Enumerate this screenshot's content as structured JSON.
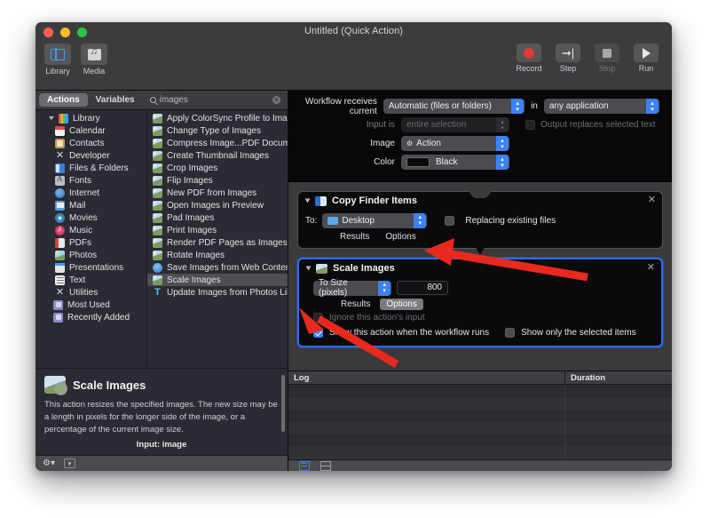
{
  "window": {
    "title": "Untitled (Quick Action)",
    "traffic_lights": [
      "close",
      "minimize",
      "zoom"
    ]
  },
  "toolbar": {
    "left": [
      {
        "icon": "library-icon",
        "label": "Library",
        "active": true
      },
      {
        "icon": "media-icon",
        "label": "Media",
        "active": false
      }
    ],
    "right": [
      {
        "icon": "record-icon",
        "label": "Record",
        "enabled": true
      },
      {
        "icon": "step-icon",
        "label": "Step",
        "enabled": true
      },
      {
        "icon": "stop-icon",
        "label": "Stop",
        "enabled": false
      },
      {
        "icon": "run-icon",
        "label": "Run",
        "enabled": true
      }
    ]
  },
  "library": {
    "segments": [
      {
        "label": "Actions",
        "active": true
      },
      {
        "label": "Variables",
        "active": false
      }
    ],
    "search": {
      "value": "images",
      "placeholder": "Search",
      "icon": "search-icon",
      "clear_icon": "clear-icon"
    },
    "categories": [
      {
        "label": "Library",
        "icon": "library-color-icon",
        "level": 0,
        "disclosure": true
      },
      {
        "label": "Calendar",
        "icon": "calendar-icon",
        "level": 1
      },
      {
        "label": "Contacts",
        "icon": "contacts-icon",
        "level": 1
      },
      {
        "label": "Developer",
        "icon": "developer-icon",
        "level": 1
      },
      {
        "label": "Files & Folders",
        "icon": "files-folders-icon",
        "level": 1
      },
      {
        "label": "Fonts",
        "icon": "fonts-icon",
        "level": 1
      },
      {
        "label": "Internet",
        "icon": "internet-icon",
        "level": 1
      },
      {
        "label": "Mail",
        "icon": "mail-icon",
        "level": 1
      },
      {
        "label": "Movies",
        "icon": "movies-icon",
        "level": 1
      },
      {
        "label": "Music",
        "icon": "music-icon",
        "level": 1
      },
      {
        "label": "PDFs",
        "icon": "pdfs-icon",
        "level": 1
      },
      {
        "label": "Photos",
        "icon": "photos-icon",
        "level": 1
      },
      {
        "label": "Presentations",
        "icon": "presentations-icon",
        "level": 1
      },
      {
        "label": "Text",
        "icon": "text-icon",
        "level": 1
      },
      {
        "label": "Utilities",
        "icon": "utilities-icon",
        "level": 1
      },
      {
        "label": "Most Used",
        "icon": "smart-folder-icon",
        "level": 0
      },
      {
        "label": "Recently Added",
        "icon": "smart-folder-icon",
        "level": 0
      }
    ],
    "actions": [
      {
        "label": "Apply ColorSync Profile to Images",
        "icon": "action-image-icon",
        "selected": false
      },
      {
        "label": "Change Type of Images",
        "icon": "action-image-icon",
        "selected": false
      },
      {
        "label": "Compress Image...PDF Documents",
        "icon": "action-image-icon",
        "selected": false
      },
      {
        "label": "Create Thumbnail Images",
        "icon": "action-image-icon",
        "selected": false
      },
      {
        "label": "Crop Images",
        "icon": "action-image-icon",
        "selected": false
      },
      {
        "label": "Flip Images",
        "icon": "action-image-icon",
        "selected": false
      },
      {
        "label": "New PDF from Images",
        "icon": "action-image-icon",
        "selected": false
      },
      {
        "label": "Open Images in Preview",
        "icon": "action-image-icon",
        "selected": false
      },
      {
        "label": "Pad Images",
        "icon": "action-image-icon",
        "selected": false
      },
      {
        "label": "Print Images",
        "icon": "action-image-icon",
        "selected": false
      },
      {
        "label": "Render PDF Pages as Images",
        "icon": "action-image-icon",
        "selected": false
      },
      {
        "label": "Rotate Images",
        "icon": "action-image-icon",
        "selected": false
      },
      {
        "label": "Save Images from Web Content",
        "icon": "action-web-icon",
        "selected": false
      },
      {
        "label": "Scale Images",
        "icon": "action-image-icon",
        "selected": true
      },
      {
        "label": "Update Images from Photos Library",
        "icon": "action-text-icon",
        "selected": false
      }
    ]
  },
  "info": {
    "icon": "scale-images-icon",
    "title": "Scale Images",
    "description": "This action resizes the specified images. The new size may be a length in pixels for the longer side of the image, or a percentage of the current image size.",
    "input": "Input: image"
  },
  "status_bar": {
    "gear_icon": "gear-icon",
    "gear_caret": "chevron-down-icon",
    "view_icon": "caret-box-icon"
  },
  "workflow_settings": {
    "rows": [
      {
        "label": "Workflow receives current",
        "value": "Automatic (files or folders)",
        "disabled": false
      },
      {
        "label": "Input is",
        "value": "entire selection",
        "disabled": true
      },
      {
        "label": "Image",
        "value": "Action",
        "disabled": false,
        "glyph": "gear-icon"
      },
      {
        "label": "Color",
        "value": "Black",
        "disabled": false,
        "swatch": "#0b0b0c"
      }
    ],
    "in_label": "in",
    "application_value": "any application",
    "output_replaces": {
      "label": "Output replaces selected text",
      "checked": false,
      "disabled": true
    }
  },
  "workflow_actions": [
    {
      "title": "Copy Finder Items",
      "icon": "finder-icon",
      "selected": false,
      "close_icon": "close-icon",
      "disclosure_icon": "disclosure-triangle-icon",
      "to_label": "To:",
      "destination": "Desktop",
      "destination_icon": "folder-icon",
      "replacing": {
        "label": "Replacing existing files",
        "checked": false
      },
      "buttons": [
        {
          "label": "Results",
          "active": false
        },
        {
          "label": "Options",
          "active": false
        }
      ]
    },
    {
      "title": "Scale Images",
      "icon": "scale-images-icon",
      "selected": true,
      "close_icon": "close-icon",
      "disclosure_icon": "disclosure-triangle-icon",
      "mode": "To Size (pixels)",
      "size_value": "800",
      "buttons": [
        {
          "label": "Results",
          "active": false
        },
        {
          "label": "Options",
          "active": true
        }
      ],
      "options": [
        {
          "label": "Ignore this action's input",
          "checked": false,
          "disabled": true
        },
        {
          "label": "Show this action when the workflow runs",
          "checked": true,
          "disabled": false
        },
        {
          "label": "Show only the selected items",
          "checked": false,
          "disabled": false
        }
      ]
    }
  ],
  "log": {
    "columns": [
      "Log",
      "Duration"
    ],
    "rows": [],
    "footer": {
      "log_view_icon": "log-view-icon",
      "split-view_icon": "split-view-icon"
    }
  },
  "annotations": {
    "arrow_color": "#e82a1e",
    "arrows": [
      {
        "name": "arrow-to-size-field",
        "points": "800 value field"
      },
      {
        "name": "arrow-to-show-action-checkbox",
        "points": "Show this action when the workflow runs checkbox"
      }
    ]
  }
}
